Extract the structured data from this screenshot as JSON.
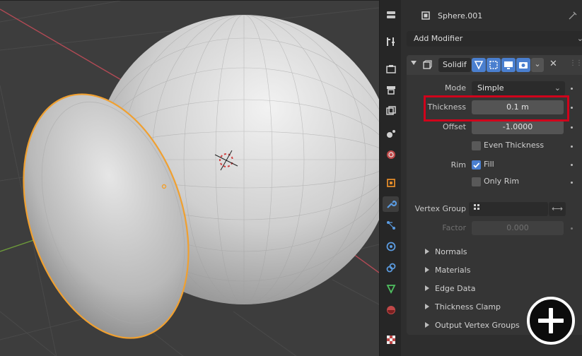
{
  "header": {
    "object_name": "Sphere.001"
  },
  "modifier_menu": {
    "label": "Add Modifier"
  },
  "modifier": {
    "name": "Solidif",
    "fields": {
      "mode_label": "Mode",
      "mode_value": "Simple",
      "thickness_label": "Thickness",
      "thickness_value": "0.1 m",
      "offset_label": "Offset",
      "offset_value": "-1.0000",
      "even_thickness_label": "Even Thickness",
      "even_thickness_checked": false,
      "rim_label": "Rim",
      "fill_label": "Fill",
      "fill_checked": true,
      "only_rim_label": "Only Rim",
      "only_rim_checked": false,
      "vertex_group_label": "Vertex Group",
      "factor_label": "Factor",
      "factor_value": "0.000"
    },
    "subpanels": [
      "Normals",
      "Materials",
      "Edge Data",
      "Thickness Clamp",
      "Output Vertex Groups"
    ]
  },
  "colors": {
    "selection_outline": "#f0a030",
    "highlight_box": "#d0021b",
    "accent": "#4a7fcf",
    "axis_x": "#b24a55",
    "axis_y": "#6e9c3a"
  },
  "icons": {
    "tabs": [
      "tool-icon",
      "render-icon",
      "output-icon",
      "view-layer-icon",
      "scene-icon",
      "world-icon",
      "object-icon",
      "modifier-icon",
      "particles-icon",
      "physics-icon",
      "constraints-icon",
      "object-data-icon",
      "material-icon",
      "texture-icon"
    ],
    "overlay": "add-circle-icon"
  }
}
